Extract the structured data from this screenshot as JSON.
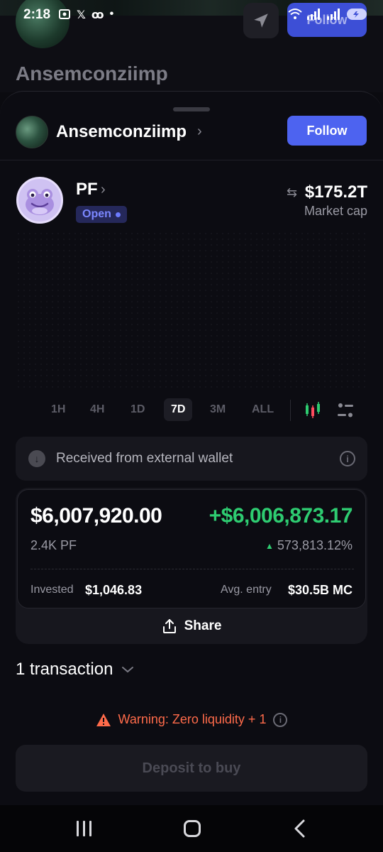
{
  "status_bar": {
    "time": "2:18",
    "left_icons": [
      "screenshot-icon",
      "x-icon",
      "logo-icon",
      "dot-icon"
    ],
    "right_icons": [
      "wifi-icon",
      "signal-icon",
      "signal-icon",
      "battery-icon"
    ]
  },
  "background": {
    "username": "Ansemconziimp",
    "follow_label": "Follow"
  },
  "profile": {
    "name": "Ansemconziimp",
    "follow_label": "Follow"
  },
  "token": {
    "symbol": "PF",
    "status": "Open",
    "market_cap": "$175.2T",
    "market_cap_label": "Market cap"
  },
  "timeframes": [
    "1H",
    "4H",
    "1D",
    "7D",
    "3M",
    "ALL"
  ],
  "timeframe_selected": "7D",
  "received": {
    "text": "Received from external wallet"
  },
  "position": {
    "value": "$6,007,920.00",
    "pnl": "+$6,006,873.17",
    "amount": "2.4K PF",
    "pnl_percent": "573,813.12%",
    "invested_label": "Invested",
    "invested_value": "$1,046.83",
    "avg_entry_label": "Avg. entry",
    "avg_entry_value": "$30.5B MC"
  },
  "share_label": "Share",
  "transactions_label": "1 transaction",
  "warning": {
    "text": "Warning: Zero liquidity + 1"
  },
  "deposit_label": "Deposit to buy",
  "colors": {
    "accent": "#4d63f0",
    "positive": "#2ecc71",
    "warning": "#ff6b4a",
    "background": "#0c0c12"
  }
}
